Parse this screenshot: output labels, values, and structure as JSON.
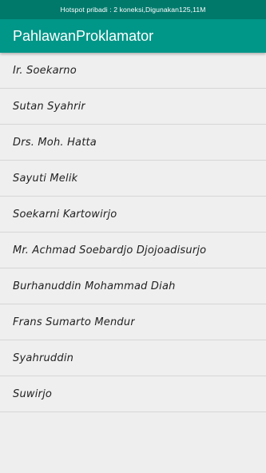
{
  "status_bar": {
    "text": "Hotspot pribadi : 2 koneksi,Digunakan125,11M"
  },
  "app_bar": {
    "title": "PahlawanProklamator"
  },
  "list": {
    "items": [
      "Ir. Soekarno",
      "Sutan Syahrir",
      "Drs. Moh. Hatta",
      "Sayuti Melik",
      "Soekarni Kartowirjo",
      "Mr. Achmad Soebardjo Djojoadisurjo",
      "Burhanuddin Mohammad Diah",
      "Frans Sumarto Mendur",
      "Syahruddin",
      "Suwirjo"
    ]
  },
  "colors": {
    "status_bar": "#00796b",
    "app_bar": "#009688",
    "background": "#eeeeee"
  }
}
